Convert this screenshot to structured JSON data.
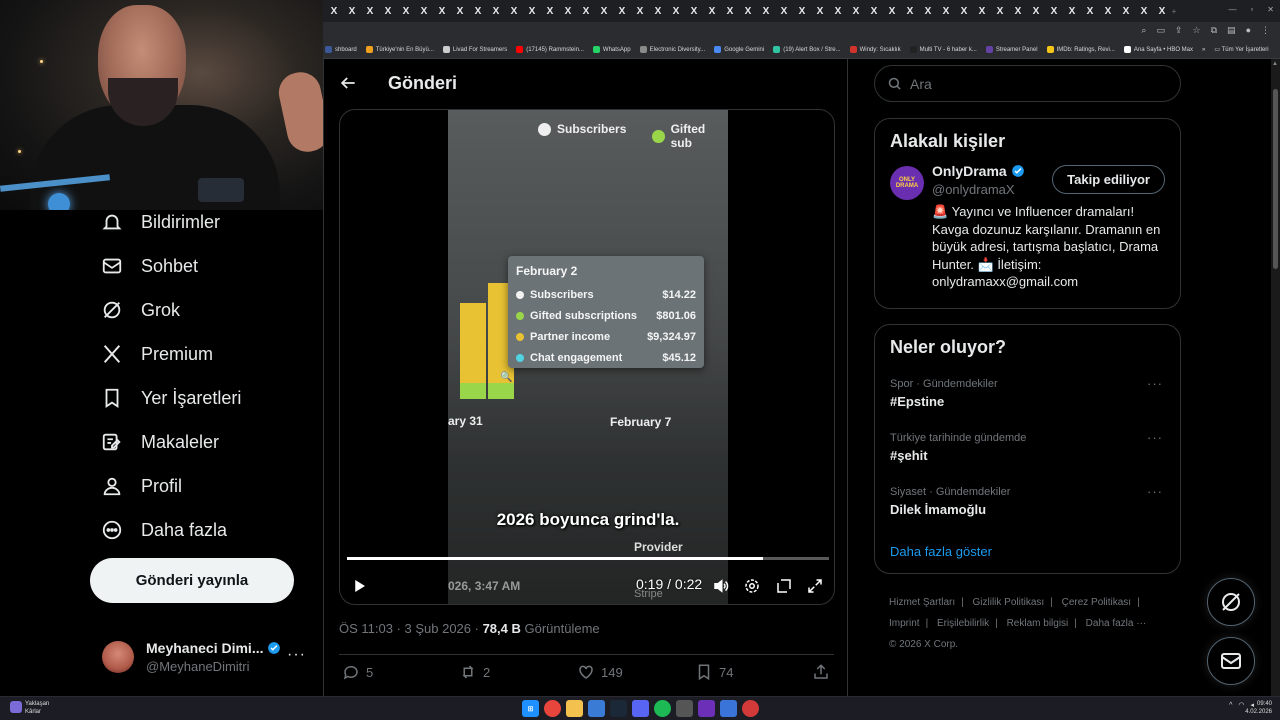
{
  "browser": {
    "tab_label": "X",
    "tab_count": 47,
    "bookmarks": [
      {
        "label": "shboard",
        "color": "#3b5998"
      },
      {
        "label": "Türkiye'nin En Büyü...",
        "color": "#f0a020"
      },
      {
        "label": "Livad For Streamers",
        "color": "#cccccc"
      },
      {
        "label": "(17145) Rammstein...",
        "color": "#ff0000"
      },
      {
        "label": "WhatsApp",
        "color": "#25d366"
      },
      {
        "label": "Electronic Diversity...",
        "color": "#8a8a8a"
      },
      {
        "label": "Google Gemini",
        "color": "#4a8af4"
      },
      {
        "label": "(19) Alert Box / Stre...",
        "color": "#31c3a2"
      },
      {
        "label": "Windy: Sıcaklık",
        "color": "#d0342c"
      },
      {
        "label": "Multi TV - 6 haber k...",
        "color": "#222222"
      },
      {
        "label": "Streamer Panel",
        "color": "#6441a5"
      },
      {
        "label": "IMDb: Ratings, Revi...",
        "color": "#f5c518"
      },
      {
        "label": "Ana Sayfa • HBO Max",
        "color": "#ffffff"
      }
    ],
    "bookmarks_more": "»",
    "all_bookmarks": "Tüm Yer İşaretleri"
  },
  "nav": {
    "items": [
      {
        "label": "Bildirimler",
        "icon": "bell-icon"
      },
      {
        "label": "Sohbet",
        "icon": "mail-icon"
      },
      {
        "label": "Grok",
        "icon": "grok-icon"
      },
      {
        "label": "Premium",
        "icon": "x-logo-icon"
      },
      {
        "label": "Yer İşaretleri",
        "icon": "bookmark-icon"
      },
      {
        "label": "Makaleler",
        "icon": "article-icon"
      },
      {
        "label": "Profil",
        "icon": "person-icon"
      },
      {
        "label": "Daha fazla",
        "icon": "more-circle-icon"
      }
    ],
    "post_button": "Gönderi yayınla",
    "account": {
      "name": "Meyhaneci Dimi...",
      "handle": "@MeyhaneDimitri",
      "more": "···"
    }
  },
  "main": {
    "title": "Gönderi",
    "video": {
      "legend": [
        {
          "label": "Subscribers",
          "color": "#eeeeee"
        },
        {
          "label": "Gifted sub",
          "color": "#9ad64a"
        }
      ],
      "tooltip": {
        "date": "February 2",
        "rows": [
          {
            "label": "Subscribers",
            "value": "$14.22",
            "color": "#f2f2f2"
          },
          {
            "label": "Gifted subscriptions",
            "value": "$801.06",
            "color": "#9ad64a"
          },
          {
            "label": "Partner income",
            "value": "$9,324.97",
            "color": "#e8c233"
          },
          {
            "label": "Chat engagement",
            "value": "$45.12",
            "color": "#4fd4e0"
          }
        ]
      },
      "axis_left": "ary 31",
      "axis_right": "February 7",
      "caption": "2026 boyunca grind'la.",
      "provider": "Provider",
      "stamp": "026, 3:47 AM",
      "stripe": "Stripe",
      "time": "0:19 / 0:22",
      "progress": 0.863
    },
    "meta": {
      "datetime": "ÖS 11:03 · 3 Şub 2026 · ",
      "views": "78,4 B",
      "views_label": " Görüntüleme"
    },
    "actions": {
      "replies": "5",
      "reposts": "2",
      "likes": "149",
      "bookmarks": "74"
    }
  },
  "right": {
    "search_placeholder": "Ara",
    "related_title": "Alakalı kişiler",
    "person": {
      "name": "OnlyDrama",
      "handle": "@onlydramaX",
      "avatar_text": "ONLY DRAMA",
      "follow_label": "Takip ediliyor",
      "bio": "🚨 Yayıncı ve Influencer dramaları! Kavga dozunuz karşılanır. Dramanın en büyük adresi, tartışma başlatıcı, Drama Hunter. 📩 İletişim: onlydramaxx@gmail.com"
    },
    "trends_title": "Neler oluyor?",
    "trends": [
      {
        "category": "Spor · Gündemdekiler",
        "name": "#Epstine"
      },
      {
        "category": "Türkiye tarihinde gündemde",
        "name": "#şehit"
      },
      {
        "category": "Siyaset · Gündemdekiler",
        "name": "Dilek İmamoğlu"
      }
    ],
    "trend_more": "···",
    "show_more": "Daha fazla göster",
    "footer": [
      "Hizmet Şartları",
      "|",
      "Gizlilik Politikası",
      "|",
      "Çerez Politikası",
      "|",
      "Imprint",
      "|",
      "Erişilebilirlik",
      "|",
      "Reklam bilgisi",
      "|",
      "Daha fazla ···",
      "© 2026 X Corp."
    ]
  },
  "taskbar": {
    "weather_title": "Yaklaşan",
    "weather_sub": "Kârlar",
    "time": "09:40",
    "date": "4.02.2026",
    "tray": "^"
  }
}
